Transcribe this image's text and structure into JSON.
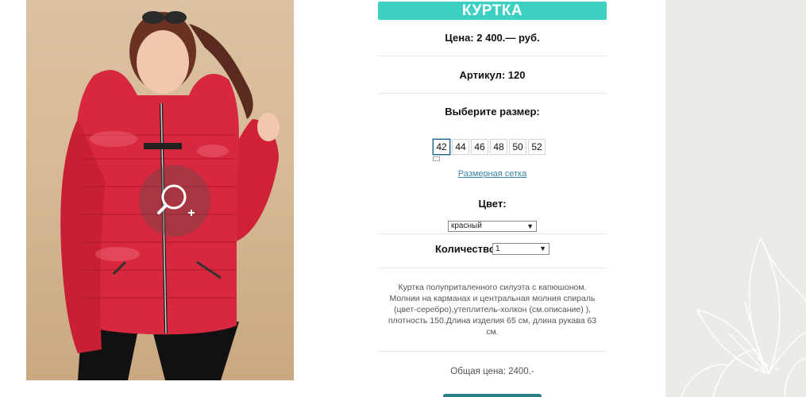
{
  "product": {
    "title": "КУРТКА",
    "price_text": "Цена: 2 400.— руб.",
    "article_text": "Артикул: 120",
    "choose_size_label": "Выберите размер:",
    "sizes": [
      "42",
      "44",
      "46",
      "48",
      "50",
      "52"
    ],
    "selected_size": "42",
    "size_chart_link": "Размерная сетка",
    "color_label": "Цвет:",
    "color_value": "красный",
    "quantity_label": "Количество:",
    "quantity_value": "1",
    "description": "Куртка полуприталенного силуэта с капюшоном. Молнии на карманах и центральная молния спираль (цвет-серебро),утеплитель-холкон (см.описание) ), плотность 150.Длина изделия 65 см, длина рукава 63 см.",
    "total_text": "Общая цена: 2400.-"
  },
  "icons": {
    "zoom": "zoom-in-icon"
  },
  "colors": {
    "accent": "#3ecfc3",
    "link": "#3a86a8",
    "button": "#2a7f86",
    "jacket": "#d8283f"
  }
}
